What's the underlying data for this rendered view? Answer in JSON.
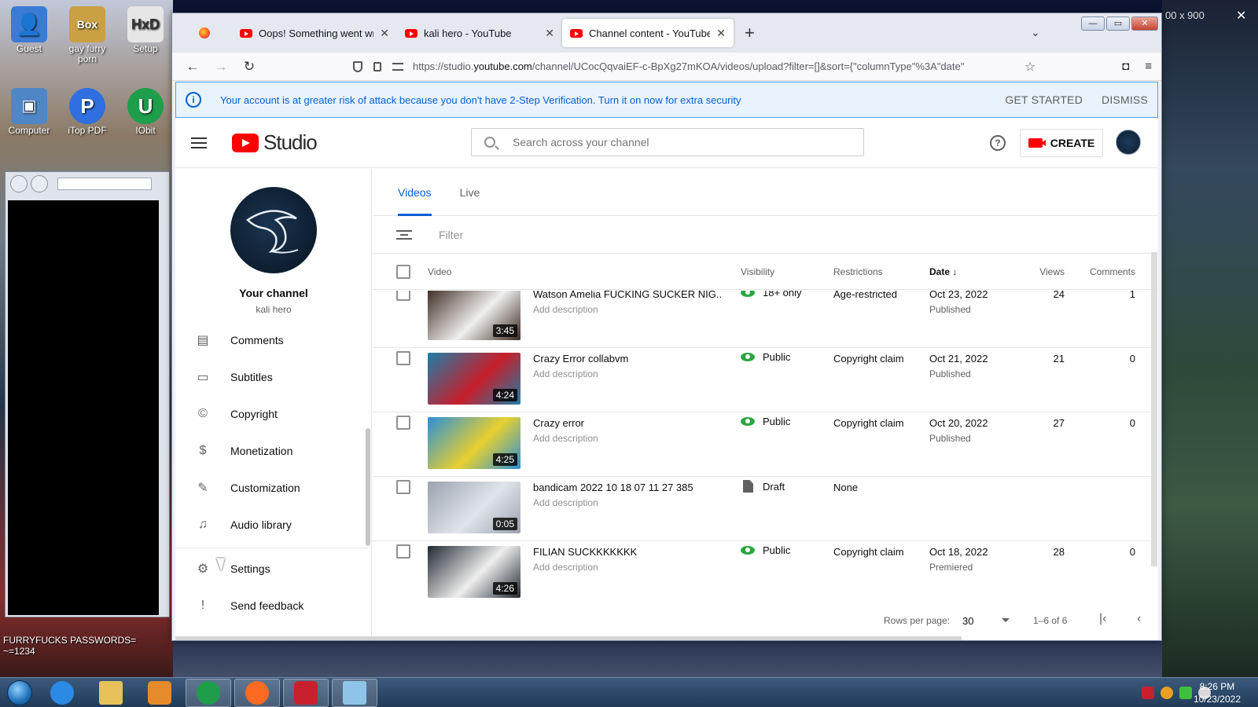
{
  "desktop": {
    "icons": [
      {
        "label": "Guest",
        "icon": "user-icon",
        "color": "#3a7bd5"
      },
      {
        "label": "gay furry porn",
        "icon": "box-app-icon",
        "color": "#c9a043"
      },
      {
        "label": "Setup",
        "icon": "hxd-icon",
        "color": "#e6e6e6"
      },
      {
        "label": "Computer",
        "icon": "computer-icon",
        "color": "#4f86c6"
      },
      {
        "label": "iTop PDF",
        "icon": "pdf-icon",
        "color": "#2f6fe0"
      },
      {
        "label": "IObit Uninstaller",
        "icon": "iobit-icon",
        "color": "#1e9e4a"
      }
    ],
    "note": "FURRYFUCKS PASSWORDS=\n~=1234",
    "resolution_badge": "00 x 900",
    "close_glyph": "✕"
  },
  "taskbar": {
    "items": [
      {
        "name": "ie-icon",
        "color": "#2b8ae6"
      },
      {
        "name": "explorer-icon",
        "color": "#e8c15a"
      },
      {
        "name": "media-player-icon",
        "color": "#e58b2b"
      },
      {
        "name": "iobit-icon",
        "color": "#1e9e4a"
      },
      {
        "name": "firefox-icon",
        "color": "#ff6a22"
      },
      {
        "name": "bandicam-icon",
        "color": "#c8202c"
      },
      {
        "name": "app-icon",
        "color": "#8fc4e8"
      }
    ],
    "clock_time": "8:26 PM",
    "clock_date": "10/23/2022"
  },
  "browser": {
    "tabs": [
      {
        "label": "Oops! Something went wrong.",
        "active": false
      },
      {
        "label": "kali hero - YouTube",
        "active": false
      },
      {
        "label": "Channel content - YouTube Studio",
        "active": true
      }
    ],
    "new_tab": "+",
    "list_all_tabs": "⌄",
    "url_prefix": "https://studio.",
    "url_domain": "youtube.com",
    "url_rest": "/channel/UCocQqvaiEF-c-BpXg27mKOA/videos/upload?filter=[]&sort={\"columnType\"%3A\"date\""
  },
  "banner": {
    "text": "Your account is at greater risk of attack because you don't have 2-Step Verification. Turn it on now for extra security",
    "get_started": "GET STARTED",
    "dismiss": "DISMISS"
  },
  "header": {
    "logo": "Studio",
    "search_placeholder": "Search across your channel",
    "create": "CREATE"
  },
  "sidebar": {
    "channel_title": "Your channel",
    "channel_name": "kali hero",
    "items": [
      {
        "label": "Comments",
        "icon": "comments-icon",
        "glyph": "▤"
      },
      {
        "label": "Subtitles",
        "icon": "subtitles-icon",
        "glyph": "▭"
      },
      {
        "label": "Copyright",
        "icon": "copyright-icon",
        "glyph": "©"
      },
      {
        "label": "Monetization",
        "icon": "dollar-icon",
        "glyph": "$"
      },
      {
        "label": "Customization",
        "icon": "magic-wand-icon",
        "glyph": "✎"
      },
      {
        "label": "Audio library",
        "icon": "audio-library-icon",
        "glyph": "♫"
      },
      {
        "label": "Settings",
        "icon": "gear-icon",
        "glyph": "⚙"
      },
      {
        "label": "Send feedback",
        "icon": "feedback-icon",
        "glyph": "!"
      }
    ]
  },
  "content": {
    "tabs": [
      "Videos",
      "Live"
    ],
    "filter_placeholder": "Filter",
    "columns": {
      "video": "Video",
      "visibility": "Visibility",
      "restrictions": "Restrictions",
      "date": "Date",
      "date_sort": "↓",
      "views": "Views",
      "comments": "Comments"
    },
    "rows": [
      {
        "title": "Watson Amelia FUCKING SUCKER NIG...",
        "description": "Add description",
        "duration": "3:45",
        "visibility": "18+ only",
        "vis_icon": "eye",
        "restrictions": "Age-restricted",
        "date": "Oct 23, 2022",
        "status": "Published",
        "views": "24",
        "comments": "1",
        "thumb": [
          "#3b2a20",
          "#f0f0f0"
        ]
      },
      {
        "title": "Crazy Error collabvm",
        "description": "Add description",
        "duration": "4:24",
        "visibility": "Public",
        "vis_icon": "eye",
        "restrictions": "Copyright claim",
        "date": "Oct 21, 2022",
        "status": "Published",
        "views": "21",
        "comments": "0",
        "thumb": [
          "#1c7fa8",
          "#c81e2a"
        ]
      },
      {
        "title": "Crazy error",
        "description": "Add description",
        "duration": "4:25",
        "visibility": "Public",
        "vis_icon": "eye",
        "restrictions": "Copyright claim",
        "date": "Oct 20, 2022",
        "status": "Published",
        "views": "27",
        "comments": "0",
        "thumb": [
          "#2a8fd8",
          "#e8d030"
        ]
      },
      {
        "title": "bandicam 2022 10 18 07 11 27 385",
        "description": "Add description",
        "duration": "0:05",
        "visibility": "Draft",
        "vis_icon": "draft",
        "restrictions": "None",
        "date": "",
        "status": "",
        "views": "",
        "comments": "",
        "thumb": [
          "#9aa2ae",
          "#e0e4ea"
        ]
      },
      {
        "title": "FILIAN SUCKKKKKKK",
        "description": "Add description",
        "duration": "4:26",
        "visibility": "Public",
        "vis_icon": "eye",
        "restrictions": "Copyright claim",
        "date": "Oct 18, 2022",
        "status": "Premiered",
        "views": "28",
        "comments": "0",
        "thumb": [
          "#202830",
          "#eeeeee"
        ]
      }
    ],
    "pagination": {
      "rows_per_page_label": "Rows per page:",
      "rows_per_page": "30",
      "range": "1–6 of 6",
      "first_glyph": "|‹",
      "prev_glyph": "‹"
    }
  }
}
